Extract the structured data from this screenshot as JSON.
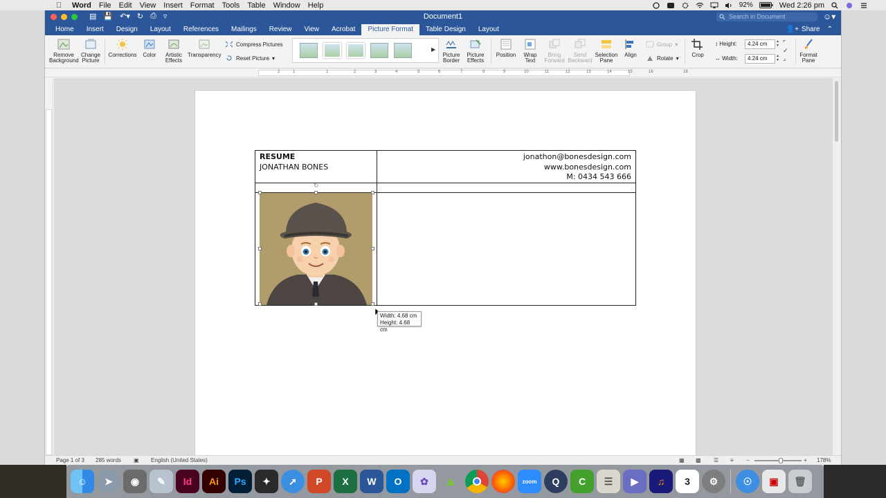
{
  "menubar": {
    "app_name": "Word",
    "items": [
      "File",
      "Edit",
      "View",
      "Insert",
      "Format",
      "Tools",
      "Table",
      "Window",
      "Help"
    ],
    "battery": "92%",
    "clock": "Wed 2:26 pm"
  },
  "window": {
    "title": "Document1",
    "search_placeholder": "Search in Document",
    "share_label": "Share"
  },
  "tabs": [
    "Home",
    "Insert",
    "Design",
    "Layout",
    "References",
    "Mailings",
    "Review",
    "View",
    "Acrobat",
    "Picture Format",
    "Table Design",
    "Layout"
  ],
  "active_tab_index": 9,
  "ribbon": {
    "remove_background": [
      "Remove",
      "Background"
    ],
    "change_picture": [
      "Change",
      "Picture"
    ],
    "corrections": "Corrections",
    "color": "Color",
    "artistic_effects": [
      "Artistic",
      "Effects"
    ],
    "transparency": "Transparency",
    "compress_pictures": "Compress Pictures",
    "reset_picture": "Reset Picture",
    "picture_border": [
      "Picture",
      "Border"
    ],
    "picture_effects": [
      "Picture",
      "Effects"
    ],
    "position": "Position",
    "wrap_text": [
      "Wrap",
      "Text"
    ],
    "bring_forward": [
      "Bring",
      "Forward"
    ],
    "send_backward": [
      "Send",
      "Backward"
    ],
    "selection_pane": [
      "Selection",
      "Pane"
    ],
    "align": "Align",
    "group": "Group",
    "rotate": "Rotate",
    "crop": "Crop",
    "height_label": "Height:",
    "height_value": "4.24 cm",
    "width_label": "Width:",
    "width_value": "4.24 cm",
    "format_pane": [
      "Format",
      "Pane"
    ]
  },
  "ruler_numbers": [
    "2",
    "1",
    "1",
    "2",
    "3",
    "4",
    "5",
    "6",
    "7",
    "8",
    "9",
    "10",
    "11",
    "12",
    "13",
    "14",
    "15",
    "16",
    "18"
  ],
  "document": {
    "resume_label": "RESUME",
    "name": "JONATHAN BONES",
    "email": "jonathon@bonesdesign.com",
    "website": "www.bonesdesign.com",
    "phone": "M: 0434 543 666",
    "tooltip_width": "Width: 4.68 cm",
    "tooltip_height": "Height: 4.68 cm"
  },
  "statusbar": {
    "page": "Page 1 of 3",
    "words": "285 words",
    "language": "English (United States)",
    "zoom": "178%"
  },
  "dock": {
    "apps": [
      "Finder",
      "Launchpad",
      "Screenshot",
      "Preview",
      "InDesign",
      "Illustrator",
      "Photoshop",
      "Acrobat",
      "Safari",
      "PowerPoint",
      "Excel",
      "Word",
      "Outlook",
      "Lasso",
      "Android Studio",
      "Chrome",
      "Firefox",
      "Zoom",
      "QuickTime",
      "Camtasia",
      "Notes",
      "Keynote",
      "Audacity",
      "Calendar",
      "System Preferences",
      "Network",
      "Screen",
      "Trash"
    ],
    "labels": {
      "indesign": "Id",
      "illustrator": "Ai",
      "photoshop": "Ps",
      "powerpoint": "P",
      "excel": "X",
      "word": "W",
      "outlook": "O",
      "zoom": "zoom",
      "calendar_day": "3"
    }
  },
  "colors": {
    "word_blue": "#2b579a",
    "ribbon_bg": "#f3f3f3",
    "doc_bg": "#dcdcdc"
  }
}
